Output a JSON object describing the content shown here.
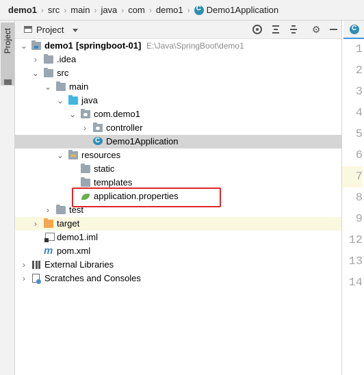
{
  "breadcrumb": {
    "items": [
      "demo1",
      "src",
      "main",
      "java",
      "com",
      "demo1",
      "Demo1Application"
    ],
    "separator": "›"
  },
  "toolstrip": {
    "project_tab": "Project"
  },
  "panel": {
    "title": "Project",
    "actions": [
      "locate-icon",
      "expand-all-icon",
      "collapse-all-icon",
      "gear-icon",
      "hide-icon"
    ]
  },
  "tree": {
    "root": {
      "name": "demo1",
      "module": "[springboot-01]",
      "path": "E:\\Java\\SpringBoot\\demo1"
    },
    "idea": ".idea",
    "src": "src",
    "main": "main",
    "java": "java",
    "com_demo1": "com.demo1",
    "controller": "controller",
    "demo1application": "Demo1Application",
    "resources": "resources",
    "static": "static",
    "templates": "templates",
    "app_properties": "application.properties",
    "test": "test",
    "target": "target",
    "demo1_iml": "demo1.iml",
    "pom_xml": "pom.xml",
    "external_libraries": "External Libraries",
    "scratches": "Scratches and Consoles"
  },
  "editor": {
    "line_numbers": [
      "1",
      "2",
      "3",
      "4",
      "5",
      "6",
      "7",
      "8",
      "9",
      "12",
      "13",
      "14"
    ],
    "current_line": "7"
  },
  "colors": {
    "selection": "#d5d5d5",
    "highlight": "#fbf8e0",
    "annotation_box": "#e0252a",
    "source_folder": "#40b6e0",
    "excluded_folder": "#f4a750"
  }
}
